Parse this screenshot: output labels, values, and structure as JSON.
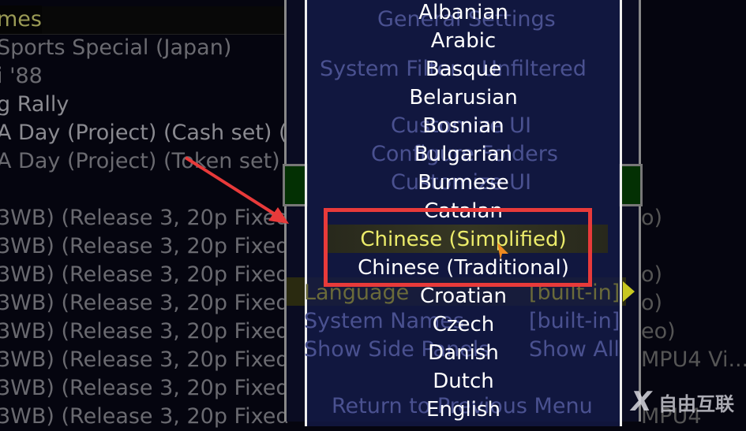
{
  "game_list": {
    "header": "mes",
    "rows": [
      "Sports Special (Japan)",
      "i '88",
      "g Rally",
      "A Day (Project) (Cash set) (PR",
      "A Day (Project) (Token set) (P",
      "",
      "3WB) (Release 3, 20p Fixed",
      "3WB) (Release 3, 20p Fixed",
      "3WB) (Release 3, 20p Fixed",
      "3WB) (Release 3, 20p Fixed",
      "3WB) (Release 3, 20p Fixed",
      "3WB) (Release 3, 20p Fixed",
      "3WB) (Release 3, 20p Fixed",
      "3WB) (Release 3, 20p Fixed"
    ]
  },
  "right_column": [
    "o)",
    "o)",
    "o)",
    "eo)",
    "MPU4 Vi...",
    "",
    "MPU4"
  ],
  "settings_menu": {
    "general_settings": "General Settings",
    "system_filter_label": "System Filter",
    "system_filter_value": "Unfiltered",
    "customize_ui": "Customize UI",
    "configure_folders": "Configure Folders",
    "customize_ui_2": "Customize UI",
    "language_label": "Language",
    "language_value": "[built-in]",
    "system_names_label": "System Names",
    "system_names_value": "[built-in]",
    "side_panels_label": "Show Side Panels",
    "side_panels_value": "Show All",
    "return": "Return to Previous Menu"
  },
  "language_dropdown": {
    "selected": "Chinese (Simplified)",
    "items": [
      "Albanian",
      "Arabic",
      "Basque",
      "Belarusian",
      "Bosnian",
      "Bulgarian",
      "Burmese",
      "Catalan",
      "Chinese (Simplified)",
      "Chinese (Traditional)",
      "Croatian",
      "Czech",
      "Danish",
      "Dutch",
      "English"
    ]
  },
  "annotation": {
    "color": "#e83a3a"
  },
  "watermark": "自由互联"
}
